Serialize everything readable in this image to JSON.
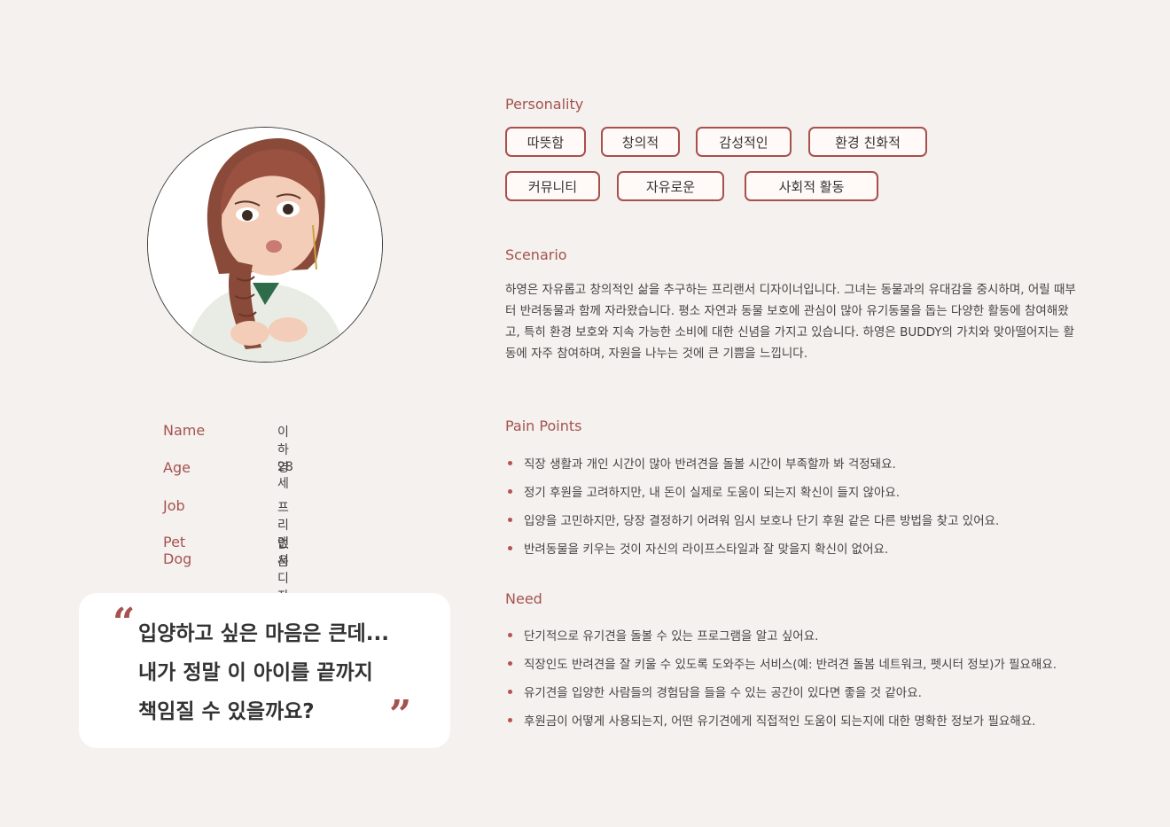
{
  "profile": {
    "info": [
      {
        "label": "Name",
        "value": "이하영"
      },
      {
        "label": "Age",
        "value": "28세"
      },
      {
        "label": "Job",
        "value": "프리랜서 디자이너"
      },
      {
        "label": "Pet Dog",
        "value": "없음"
      }
    ]
  },
  "quote": {
    "open_mark": "“",
    "close_mark": "”",
    "lines": [
      "입양하고 싶은 마음은 큰데...",
      "내가 정말 이 아이를 끝까지",
      "책임질 수 있을까요?"
    ]
  },
  "personality": {
    "title": "Personality",
    "tags": [
      "따뜻함",
      "창의적",
      "감성적인",
      "환경 친화적",
      "커뮤니티",
      "자유로운",
      "사회적 활동"
    ]
  },
  "scenario": {
    "title": "Scenario",
    "text": "하영은 자유롭고 창의적인 삶을 추구하는 프리랜서 디자이너입니다. 그녀는 동물과의 유대감을 중시하며, 어릴 때부터 반려동물과 함께 자라왔습니다. 평소 자연과 동물 보호에 관심이 많아 유기동물을 돕는 다양한 활동에 참여해왔고, 특히 환경 보호와 지속 가능한 소비에 대한 신념을 가지고 있습니다. 하영은 BUDDY의 가치와 맞아떨어지는 활동에 자주 참여하며, 자원을 나누는 것에 큰 기쁨을 느낍니다."
  },
  "pain_points": {
    "title": "Pain Points",
    "items": [
      "직장 생활과 개인 시간이 많아 반려견을 돌볼 시간이 부족할까 봐 걱정돼요.",
      "정기 후원을 고려하지만, 내 돈이 실제로 도움이 되는지 확신이 들지 않아요.",
      "입양을 고민하지만, 당장 결정하기 어려워 임시 보호나 단기 후원 같은 다른 방법을 찾고 있어요.",
      "반려동물을 키우는 것이 자신의 라이프스타일과 잘 맞을지 확신이 없어요."
    ]
  },
  "need": {
    "title": "Need",
    "items": [
      "단기적으로 유기견을 돌볼 수 있는 프로그램을 알고 싶어요.",
      "직장인도 반려견을 잘 키울 수 있도록 도와주는 서비스(예: 반려견 돌봄 네트워크, 펫시터 정보)가 필요해요.",
      "유기견을 입양한 사람들의 경험담을 들을 수 있는 공간이 있다면 좋을 것 같아요.",
      "후원금이 어떻게 사용되는지, 어떤 유기견에게 직접적인 도움이 되는지에 대한 명확한 정보가 필요해요."
    ]
  },
  "colors": {
    "accent": "#a5534f",
    "background": "#f4f1ee",
    "card": "#ffffff"
  }
}
